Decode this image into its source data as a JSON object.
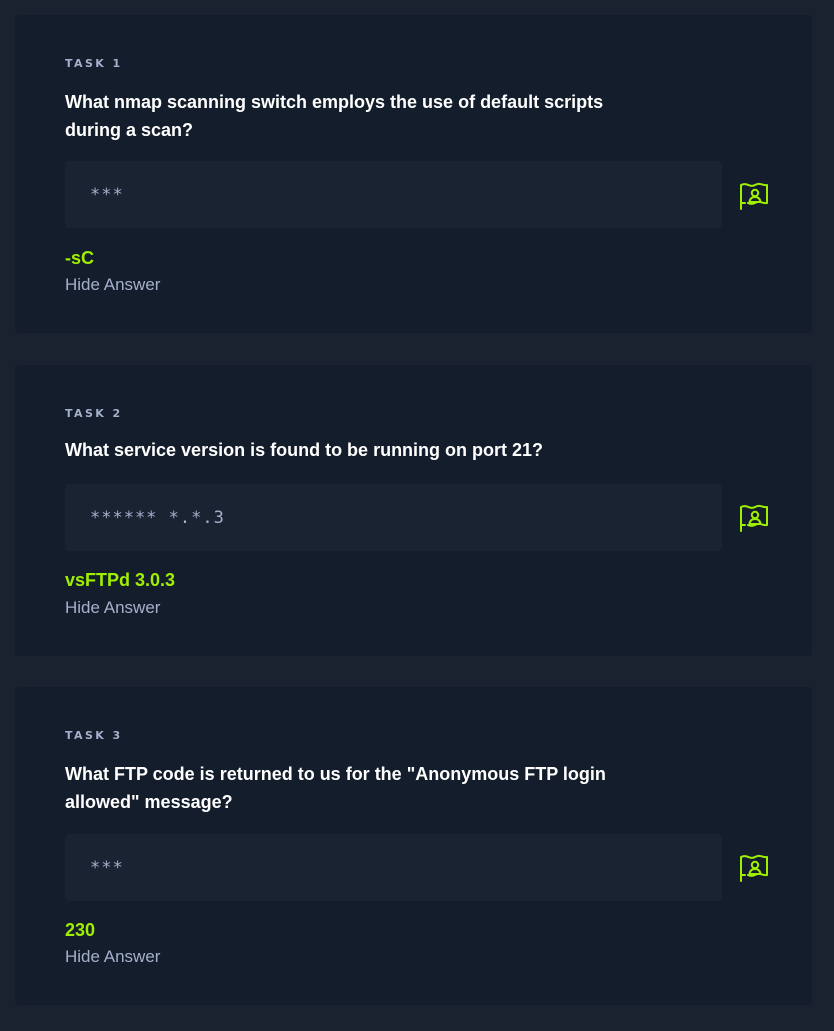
{
  "accent_color": "#9fef00",
  "tasks": [
    {
      "label": "TASK 1",
      "question": "What nmap scanning switch employs the use of default scripts during a scan?",
      "answer_mask": "***",
      "answer": "-sC",
      "hide_label": "Hide Answer",
      "submit_icon": "flag-user-icon"
    },
    {
      "label": "TASK 2",
      "question": "What service version is found to be running on port 21?",
      "answer_mask": "****** *.*.3",
      "answer": "vsFTPd 3.0.3",
      "hide_label": "Hide Answer",
      "submit_icon": "flag-user-icon"
    },
    {
      "label": "TASK 3",
      "question": "What FTP code is returned to us for the \"Anonymous FTP login allowed\" message?",
      "answer_mask": "***",
      "answer": "230",
      "hide_label": "Hide Answer",
      "submit_icon": "flag-user-icon"
    }
  ]
}
